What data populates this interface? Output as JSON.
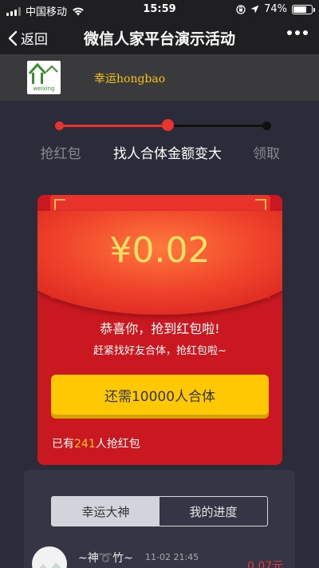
{
  "status_bar": {
    "carrier": "中国移动",
    "time": "15:59",
    "battery": "74%",
    "battery_level": 0.74
  },
  "nav": {
    "back_label": "返回",
    "title": "微信人家平台演示活动"
  },
  "brand": {
    "logo_text": "weixing",
    "name": "幸运hongbao"
  },
  "steps": {
    "items": [
      {
        "label": "抢红包",
        "state": "done"
      },
      {
        "label": "找人合体金额变大",
        "state": "current"
      },
      {
        "label": "领取",
        "state": "todo"
      }
    ]
  },
  "packet": {
    "amount": "¥0.02",
    "congrats": "恭喜你，抢到红包啦!",
    "prompt": "赶紧找好友合体，抢红包啦~",
    "cta_label": "还需10000人合体",
    "count_prefix": "已有",
    "count_value": "241",
    "count_suffix": "人抢红包"
  },
  "tabs": [
    {
      "label": "幸运大神",
      "active": true
    },
    {
      "label": "我的进度",
      "active": false
    }
  ],
  "entry": {
    "name": "~神➰竹~",
    "time": "11-02 21:45",
    "amount": "0.07元"
  },
  "colors": {
    "accent_red": "#e8342c",
    "accent_yellow": "#fec803",
    "brand_gold": "#f5c518"
  }
}
